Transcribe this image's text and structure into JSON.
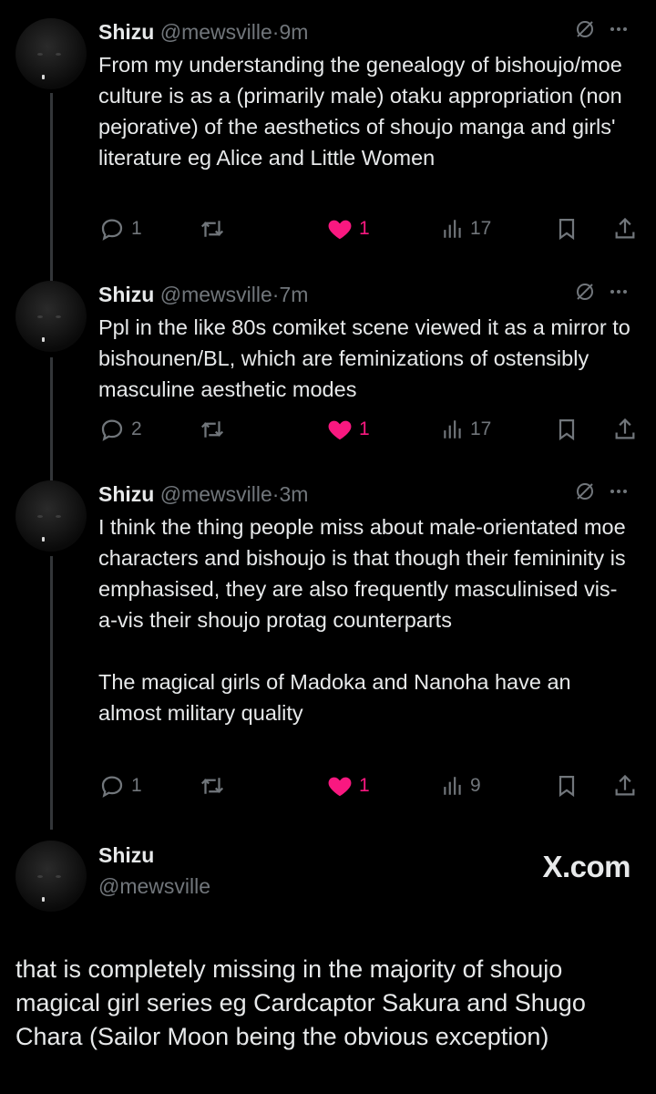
{
  "tweets": [
    {
      "name": "Shizu",
      "handle": "@mewsville",
      "dot": "·",
      "time": "9m",
      "text": "From my understanding the genealogy of bishoujo/moe culture is as a (primarily male) otaku appropriation (non pejorative) of the aesthetics of shoujo manga and girls' literature eg Alice and Little Women",
      "replies": "1",
      "retweets": "",
      "likes": "1",
      "views": "17"
    },
    {
      "name": "Shizu",
      "handle": "@mewsville",
      "dot": "·",
      "time": "7m",
      "text": "Ppl in the like 80s comiket scene viewed it as a mirror to bishounen/BL, which are feminizations of ostensibly masculine aesthetic modes",
      "replies": "2",
      "retweets": "",
      "likes": "1",
      "views": "17"
    },
    {
      "name": "Shizu",
      "handle": "@mewsville",
      "dot": "·",
      "time": "3m",
      "text": "I think the thing people miss about male-orientated moe characters and bishoujo is that though their femininity is emphasised, they are also frequently masculinised vis-a-vis their shoujo protag counterparts\n\nThe magical girls of Madoka and Nanoha have an almost military quality",
      "replies": "1",
      "retweets": "",
      "likes": "1",
      "views": "9"
    }
  ],
  "final_tweet": {
    "name": "Shizu",
    "handle": "@mewsville",
    "watermark": "X.com",
    "text": "that is completely missing in the majority of shoujo magical girl series eg Cardcaptor Sakura and Shugo Chara (Sailor Moon being the obvious exception)"
  },
  "colors": {
    "background": "#000000",
    "text": "#e7e9ea",
    "muted": "#71767b",
    "like": "#f91880",
    "thread_line": "#333639"
  },
  "icons": {
    "reply": "reply-icon",
    "retweet": "retweet-icon",
    "like": "heart-filled-icon",
    "views": "views-bar-chart-icon",
    "bookmark": "bookmark-icon",
    "share": "share-icon",
    "grok": "slash-circle-icon",
    "more": "more-horizontal-icon"
  }
}
